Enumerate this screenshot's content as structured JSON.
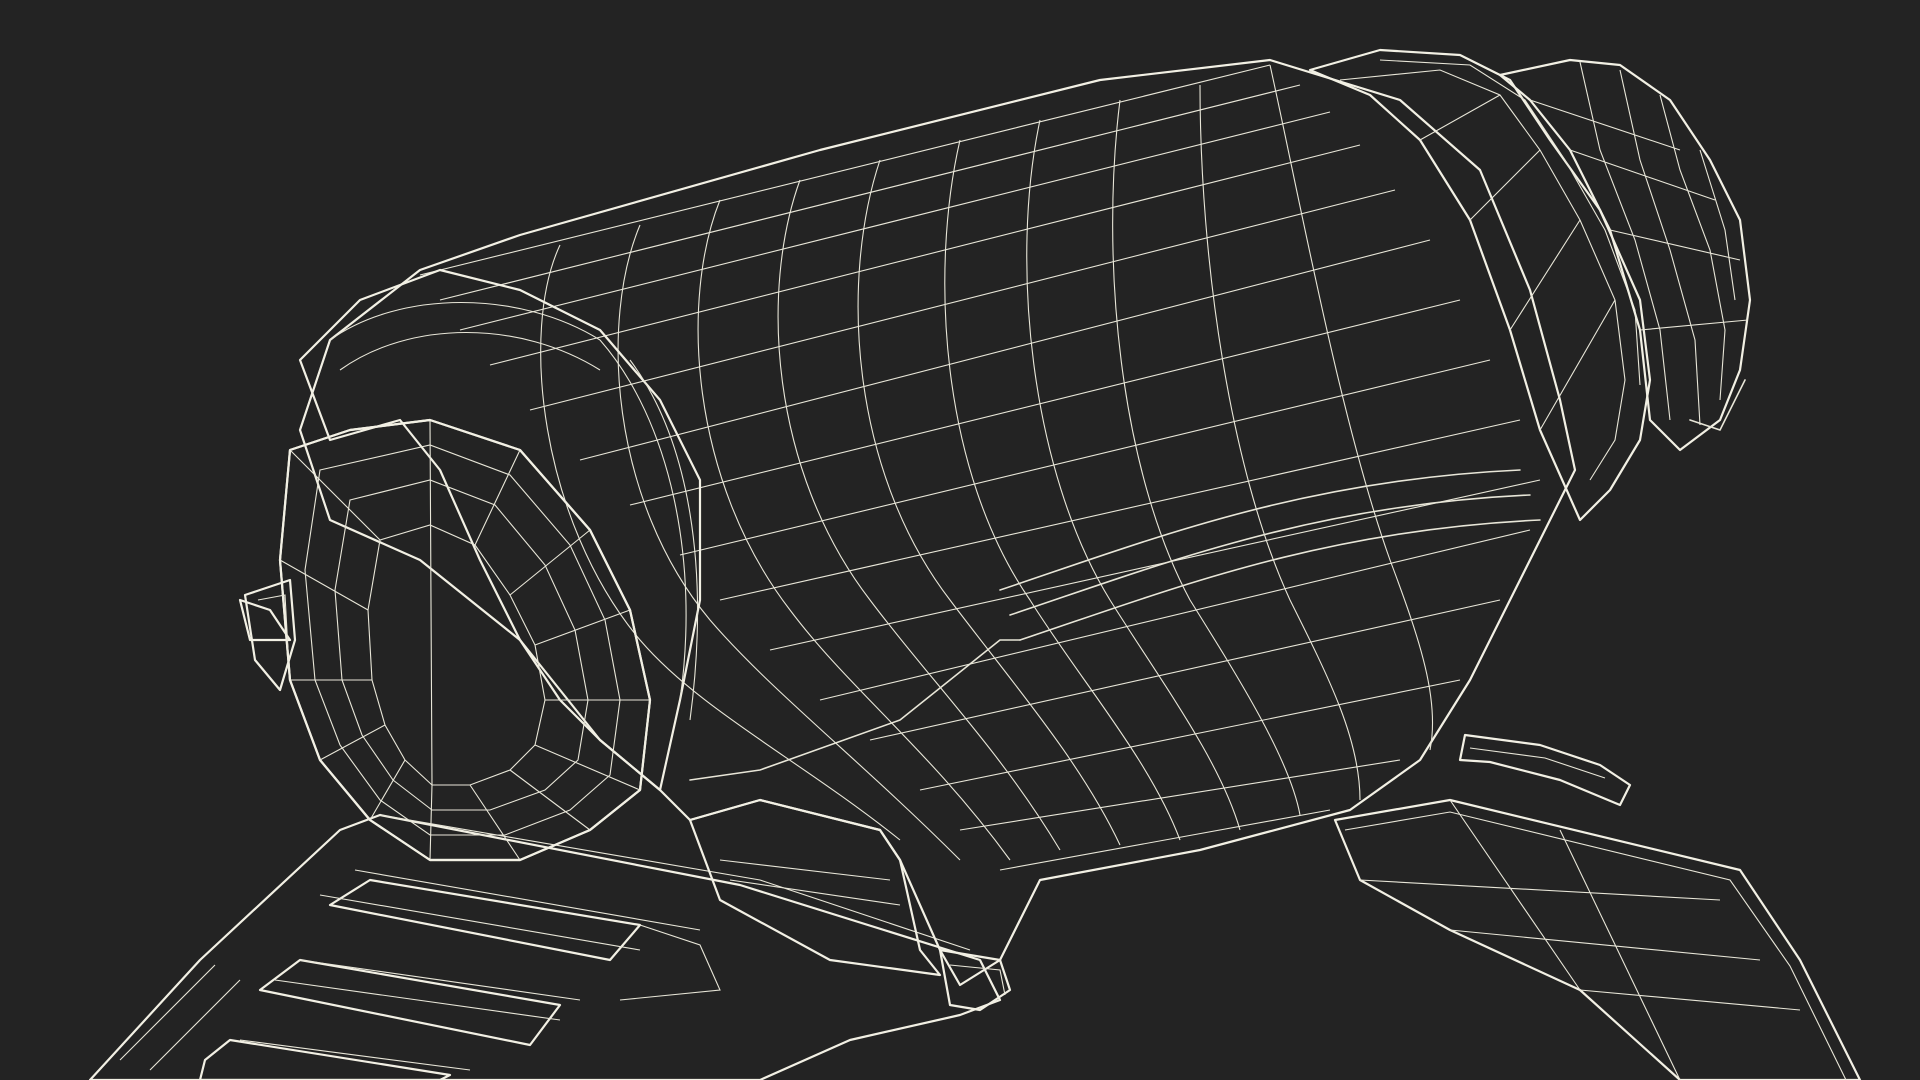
{
  "scene": {
    "subject": "wireframe-3d-model",
    "colors": {
      "background": "#232323",
      "surface": "#7b7d71",
      "surface_dark": "#5f6158",
      "surface_shadow": "#45463f",
      "surface_light": "#8a8c80",
      "wire": "#e8e6d8",
      "cavity": "#111111"
    }
  }
}
